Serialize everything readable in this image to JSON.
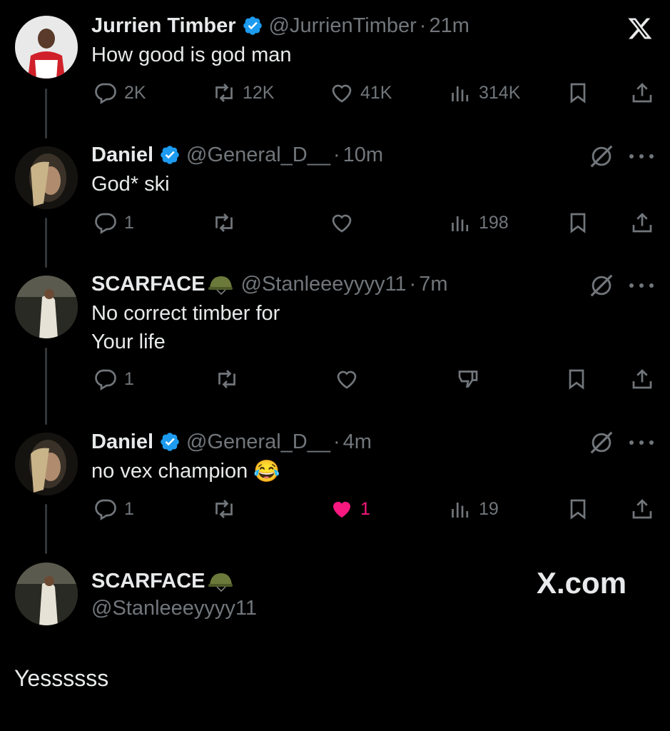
{
  "colors": {
    "background": "#000000",
    "text": "#e7e9ea",
    "muted": "#71767b",
    "verified": "#1d9bf0",
    "like_active": "#f91880"
  },
  "tweets": [
    {
      "name": "Jurrien Timber",
      "handle": "@JurrienTimber",
      "dot": "·",
      "time": "21m",
      "text": "How good is god man",
      "replies": "2K",
      "reposts": "12K",
      "likes": "41K",
      "views": "314K"
    },
    {
      "name": "Daniel",
      "handle": "@General_D__",
      "dot": "·",
      "time": "10m",
      "text": "God* ski",
      "replies": "1",
      "views": "198"
    },
    {
      "name": "SCARFACE",
      "name_emoji": "military-helmet-icon",
      "handle": "@Stanleeeyyyy11",
      "dot": "·",
      "time": "7m",
      "text": "No correct timber for\nYour life",
      "replies": "1"
    },
    {
      "name": "Daniel",
      "handle": "@General_D__",
      "dot": "·",
      "time": "4m",
      "text": "no vex champion",
      "text_emoji": "😂",
      "replies": "1",
      "likes": "1",
      "views": "19"
    }
  ],
  "focused": {
    "name": "SCARFACE",
    "handle": "@Stanleeeyyyy11",
    "text": "Yessssss"
  },
  "watermark": "X.com"
}
